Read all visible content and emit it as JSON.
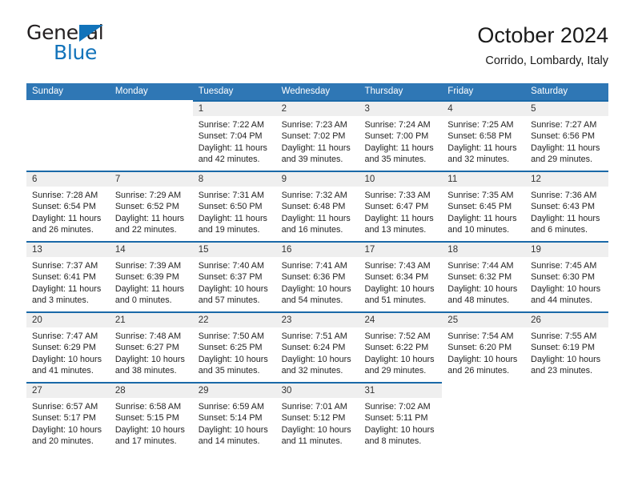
{
  "brand": {
    "name_part1": "General",
    "name_part2": "Blue",
    "colors": {
      "blue": "#1273ba",
      "dark": "#231f20"
    }
  },
  "header": {
    "title": "October 2024",
    "subtitle": "Corrido, Lombardy, Italy"
  },
  "theme": {
    "header_blue": "#2f77b5",
    "rule_blue": "#1a69a8",
    "daynum_bg": "#efefef"
  },
  "weekdays": [
    "Sunday",
    "Monday",
    "Tuesday",
    "Wednesday",
    "Thursday",
    "Friday",
    "Saturday"
  ],
  "weeks": [
    [
      {
        "day": "",
        "empty": true
      },
      {
        "day": "",
        "empty": true
      },
      {
        "day": "1",
        "sunrise": "Sunrise: 7:22 AM",
        "sunset": "Sunset: 7:04 PM",
        "daylight1": "Daylight: 11 hours",
        "daylight2": "and 42 minutes."
      },
      {
        "day": "2",
        "sunrise": "Sunrise: 7:23 AM",
        "sunset": "Sunset: 7:02 PM",
        "daylight1": "Daylight: 11 hours",
        "daylight2": "and 39 minutes."
      },
      {
        "day": "3",
        "sunrise": "Sunrise: 7:24 AM",
        "sunset": "Sunset: 7:00 PM",
        "daylight1": "Daylight: 11 hours",
        "daylight2": "and 35 minutes."
      },
      {
        "day": "4",
        "sunrise": "Sunrise: 7:25 AM",
        "sunset": "Sunset: 6:58 PM",
        "daylight1": "Daylight: 11 hours",
        "daylight2": "and 32 minutes."
      },
      {
        "day": "5",
        "sunrise": "Sunrise: 7:27 AM",
        "sunset": "Sunset: 6:56 PM",
        "daylight1": "Daylight: 11 hours",
        "daylight2": "and 29 minutes."
      }
    ],
    [
      {
        "day": "6",
        "sunrise": "Sunrise: 7:28 AM",
        "sunset": "Sunset: 6:54 PM",
        "daylight1": "Daylight: 11 hours",
        "daylight2": "and 26 minutes."
      },
      {
        "day": "7",
        "sunrise": "Sunrise: 7:29 AM",
        "sunset": "Sunset: 6:52 PM",
        "daylight1": "Daylight: 11 hours",
        "daylight2": "and 22 minutes."
      },
      {
        "day": "8",
        "sunrise": "Sunrise: 7:31 AM",
        "sunset": "Sunset: 6:50 PM",
        "daylight1": "Daylight: 11 hours",
        "daylight2": "and 19 minutes."
      },
      {
        "day": "9",
        "sunrise": "Sunrise: 7:32 AM",
        "sunset": "Sunset: 6:48 PM",
        "daylight1": "Daylight: 11 hours",
        "daylight2": "and 16 minutes."
      },
      {
        "day": "10",
        "sunrise": "Sunrise: 7:33 AM",
        "sunset": "Sunset: 6:47 PM",
        "daylight1": "Daylight: 11 hours",
        "daylight2": "and 13 minutes."
      },
      {
        "day": "11",
        "sunrise": "Sunrise: 7:35 AM",
        "sunset": "Sunset: 6:45 PM",
        "daylight1": "Daylight: 11 hours",
        "daylight2": "and 10 minutes."
      },
      {
        "day": "12",
        "sunrise": "Sunrise: 7:36 AM",
        "sunset": "Sunset: 6:43 PM",
        "daylight1": "Daylight: 11 hours",
        "daylight2": "and 6 minutes."
      }
    ],
    [
      {
        "day": "13",
        "sunrise": "Sunrise: 7:37 AM",
        "sunset": "Sunset: 6:41 PM",
        "daylight1": "Daylight: 11 hours",
        "daylight2": "and 3 minutes."
      },
      {
        "day": "14",
        "sunrise": "Sunrise: 7:39 AM",
        "sunset": "Sunset: 6:39 PM",
        "daylight1": "Daylight: 11 hours",
        "daylight2": "and 0 minutes."
      },
      {
        "day": "15",
        "sunrise": "Sunrise: 7:40 AM",
        "sunset": "Sunset: 6:37 PM",
        "daylight1": "Daylight: 10 hours",
        "daylight2": "and 57 minutes."
      },
      {
        "day": "16",
        "sunrise": "Sunrise: 7:41 AM",
        "sunset": "Sunset: 6:36 PM",
        "daylight1": "Daylight: 10 hours",
        "daylight2": "and 54 minutes."
      },
      {
        "day": "17",
        "sunrise": "Sunrise: 7:43 AM",
        "sunset": "Sunset: 6:34 PM",
        "daylight1": "Daylight: 10 hours",
        "daylight2": "and 51 minutes."
      },
      {
        "day": "18",
        "sunrise": "Sunrise: 7:44 AM",
        "sunset": "Sunset: 6:32 PM",
        "daylight1": "Daylight: 10 hours",
        "daylight2": "and 48 minutes."
      },
      {
        "day": "19",
        "sunrise": "Sunrise: 7:45 AM",
        "sunset": "Sunset: 6:30 PM",
        "daylight1": "Daylight: 10 hours",
        "daylight2": "and 44 minutes."
      }
    ],
    [
      {
        "day": "20",
        "sunrise": "Sunrise: 7:47 AM",
        "sunset": "Sunset: 6:29 PM",
        "daylight1": "Daylight: 10 hours",
        "daylight2": "and 41 minutes."
      },
      {
        "day": "21",
        "sunrise": "Sunrise: 7:48 AM",
        "sunset": "Sunset: 6:27 PM",
        "daylight1": "Daylight: 10 hours",
        "daylight2": "and 38 minutes."
      },
      {
        "day": "22",
        "sunrise": "Sunrise: 7:50 AM",
        "sunset": "Sunset: 6:25 PM",
        "daylight1": "Daylight: 10 hours",
        "daylight2": "and 35 minutes."
      },
      {
        "day": "23",
        "sunrise": "Sunrise: 7:51 AM",
        "sunset": "Sunset: 6:24 PM",
        "daylight1": "Daylight: 10 hours",
        "daylight2": "and 32 minutes."
      },
      {
        "day": "24",
        "sunrise": "Sunrise: 7:52 AM",
        "sunset": "Sunset: 6:22 PM",
        "daylight1": "Daylight: 10 hours",
        "daylight2": "and 29 minutes."
      },
      {
        "day": "25",
        "sunrise": "Sunrise: 7:54 AM",
        "sunset": "Sunset: 6:20 PM",
        "daylight1": "Daylight: 10 hours",
        "daylight2": "and 26 minutes."
      },
      {
        "day": "26",
        "sunrise": "Sunrise: 7:55 AM",
        "sunset": "Sunset: 6:19 PM",
        "daylight1": "Daylight: 10 hours",
        "daylight2": "and 23 minutes."
      }
    ],
    [
      {
        "day": "27",
        "sunrise": "Sunrise: 6:57 AM",
        "sunset": "Sunset: 5:17 PM",
        "daylight1": "Daylight: 10 hours",
        "daylight2": "and 20 minutes."
      },
      {
        "day": "28",
        "sunrise": "Sunrise: 6:58 AM",
        "sunset": "Sunset: 5:15 PM",
        "daylight1": "Daylight: 10 hours",
        "daylight2": "and 17 minutes."
      },
      {
        "day": "29",
        "sunrise": "Sunrise: 6:59 AM",
        "sunset": "Sunset: 5:14 PM",
        "daylight1": "Daylight: 10 hours",
        "daylight2": "and 14 minutes."
      },
      {
        "day": "30",
        "sunrise": "Sunrise: 7:01 AM",
        "sunset": "Sunset: 5:12 PM",
        "daylight1": "Daylight: 10 hours",
        "daylight2": "and 11 minutes."
      },
      {
        "day": "31",
        "sunrise": "Sunrise: 7:02 AM",
        "sunset": "Sunset: 5:11 PM",
        "daylight1": "Daylight: 10 hours",
        "daylight2": "and 8 minutes."
      },
      {
        "day": "",
        "empty": true
      },
      {
        "day": "",
        "empty": true
      }
    ]
  ]
}
